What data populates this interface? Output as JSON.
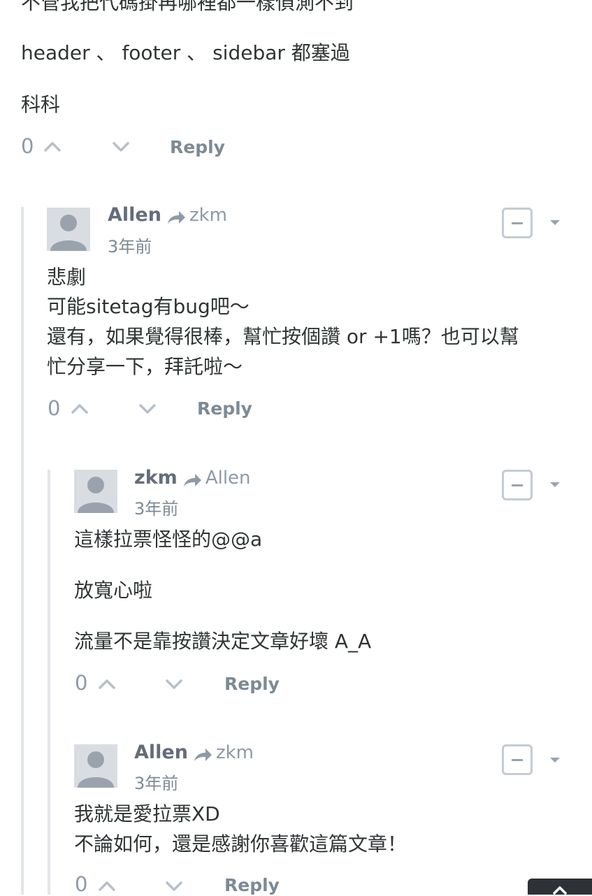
{
  "top_comment": {
    "line1": "不管我把代碼掛再哪裡都一樣偵測不到",
    "line2": "header 、 footer 、 sidebar 都塞過",
    "line3": "科科",
    "votes": "0",
    "reply_label": "Reply"
  },
  "comments": [
    {
      "author": "Allen",
      "reply_to": "zkm",
      "time": "3年前",
      "lines": [
        "悲劇",
        "可能sitetag有bug吧～",
        "還有，如果覺得很棒，幫忙按個讚 or +1嗎？也可以幫",
        "忙分享一下，拜託啦～"
      ],
      "votes": "0",
      "reply_label": "Reply"
    },
    {
      "author": "zkm",
      "reply_to": "Allen",
      "time": "3年前",
      "lines": [
        "這樣拉票怪怪的@@a",
        "放寬心啦",
        "流量不是靠按讚決定文章好壞 A_A"
      ],
      "votes": "0",
      "reply_label": "Reply"
    },
    {
      "author": "Allen",
      "reply_to": "zkm",
      "time": "3年前",
      "lines": [
        "我就是愛拉票XD",
        "不論如何，還是感謝你喜歡這篇文章！"
      ],
      "votes": "0",
      "reply_label": "Reply"
    }
  ],
  "icons": {
    "upvote": "chevron-up-icon",
    "downvote": "chevron-down-icon",
    "reply_arrow": "share-arrow-icon",
    "collapse": "minus-box-icon",
    "menu": "caret-down-icon",
    "scroll_top": "chevron-up-icon"
  },
  "colors": {
    "text": "#2f3434",
    "author": "#656c7a",
    "muted": "#8e9aa7",
    "thread_line": "#e3e6e9"
  }
}
